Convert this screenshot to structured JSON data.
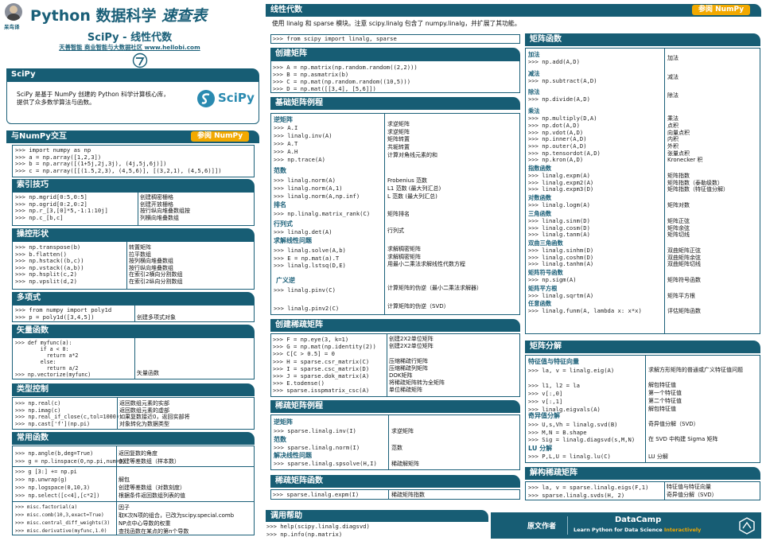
{
  "header": {
    "title": "Python 数据科学",
    "title_em": "速查表",
    "subtitle": "SciPy - 线性代数",
    "org_line1": "天善智能 商业智能与大数据社区",
    "org_url": "www.hellobi.com",
    "author": "呆鸟译"
  },
  "scipy": {
    "title": "SciPy",
    "text": "SciPy 是基于 NumPy 创建的 Python 科学计算核心库，\n提供了众多数学算法与函数。",
    "logo": "SciPy"
  },
  "numpy": {
    "title": "与NumPy交互",
    "badge": "参阅 NumPy",
    "code": ">>> import numpy as np\n>>> a = np.array([1,2,3])\n>>> b = np.array([(1+5j,2j,3j), (4j,5j,6j)])\n>>> c = np.array([[(1.5,2,3), (4,5,6)], [(3,2,1), (4,5,6)]])"
  },
  "index": {
    "title": "索引技巧",
    "code": ">>> np.mgrid[0:5,0:5]\n>>> np.ogrid[0:2,0:2]\n>>> np.r_[3,[0]*5,-1:1:10j]\n>>> np.c_[b,c]",
    "desc": "创建稠密栅格\n创建开放栅格\n按行纵向堆叠数组按\n列横向堆叠数组"
  },
  "shape": {
    "title": "操控形状",
    "code": ">>> np.transpose(b)\n>>> b.flatten()\n>>> np.hstack((b,c))\n>>> np.vstack((a,b))\n>>> np.hsplit(c,2)\n>>> np.vpslit(d,2)",
    "desc": "转置矩阵\n拉平数组\n按列横向堆叠数组\n按行纵向堆叠数组\n在索引2横向分割数组\n在索引2纵向分割数组"
  },
  "poly": {
    "title": "多项式",
    "code": ">>> from numpy import poly1d\n>>> p = poly1d([3,4,5])",
    "desc": "\n创建多项式对象"
  },
  "vec": {
    "title": "矢量函数",
    "code": ">>> def myfunc(a):\n        if a < 0:\n          return a*2\n        else:\n          return a/2\n>>> np.vectorize(myfunc)",
    "desc": "矢量函数"
  },
  "type": {
    "title": "类型控制",
    "code": ">>> np.real(c)\n>>> np.imag(c)\n>>> np.real_if_close(c,tol=1000)\n>>> np.cast['f'](np.pi)",
    "desc": "返回数组元素的实部\n返回数组元素的虚部\n如果复数接近0，返回实部将\n对象转化为数据类型"
  },
  "common": {
    "title": "常用函数",
    "code1": ">>> np.angle(b,deg=True)\n>>> g = np.linspace(0,np.pi,num=5)",
    "desc1": "返回复数的角度\n创建等差数组（样本数）",
    "code2": ">>> g [3:] += np.pi\n>>> np.unwrap(g)\n>>> np.logspace(0,10,3)\n>>> np.select([c<4],[c*2])",
    "desc2": "\n解包\n创建等差数组（对数刻度）\n根据条件返回数组列表的值",
    "code3": ">>> misc.factorial(a)\n>>> misc.comb(10,3,exact=True)\n>>> misc.central_diff_weights(3)\n>>> misc.derivative(myfunc,1.0)",
    "desc3": "因子\n取K次N项的组合，已改为scipy.special.comb\nNP点中心导数的权重\n查找函数在某点的第n个导数"
  },
  "linalg": {
    "title": "线性代数",
    "badge": "参阅 NumPy",
    "intro": "使用 linalg 和 sparse 模块。注意 scipy.linalg 包含了 numpy.linalg，并扩展了其功能。",
    "import": ">>> from scipy import linalg, sparse"
  },
  "create": {
    "title": "创建矩阵",
    "code": ">>> A = np.matrix(np.random.random((2,2)))\n>>> B = np.asmatrix(b)\n>>> C = np.mat(np.random.random((10,5)))\n>>> D = np.mat([[3,4], [5,6]])"
  },
  "basic": {
    "title": "基础矩阵例程",
    "h_inv": "逆矩阵",
    "code_inv": ">>> A.I\n>>> linalg.inv(A)\n>>> A.T\n>>> A.H\n>>> np.trace(A)",
    "desc_inv": "求逆矩阵\n求逆矩阵\n矩阵转置\n共轭转置\n计算对角线元素的和",
    "h_norm": "范数",
    "code_norm": ">>> linalg.norm(A)\n>>> linalg.norm(A,1)\n>>> linalg.norm(A,np.inf)",
    "desc_norm": "Frobenius 范数\nL1 范数 (最大列汇总)\nL 范数 (最大列汇总)",
    "h_rank": "排名",
    "code_rank": ">>> np.linalg.matrix_rank(C)",
    "desc_rank": "矩阵排名",
    "h_det": "行列式",
    "code_det": ">>> linalg.det(A)",
    "desc_det": "行列式",
    "h_solve": "求解线性问题",
    "code_solve": ">>> linalg.solve(A,b)\n>>> E = np.mat(a).T\n>>> linalg.lstsq(D,E)",
    "desc_solve": "求解稠密矩阵\n求解稠密矩阵\n用最小二乘法求解线性代数方程",
    "h_pinv": "广义逆",
    "code_pinv": ">>> linalg.pinv(C)\n\n>>> linalg.pinv2(C)",
    "desc_pinv": "计算矩阵的伪逆（最小二乘法求解器）\n\n计算矩阵的伪逆（SVD）"
  },
  "sparse_create": {
    "title": "创建稀疏矩阵",
    "code": ">>> F = np.eye(3, k=1)\n>>> G = np.mat(np.identity(2))\n>>> C[C > 0.5] = 0\n>>> H = sparse.csr_matrix(C)\n>>> I = sparse.csc_matrix(D)\n>>> J = sparse.dok_matrix(A)\n>>> E.todense()\n>>> sparse.isspmatrix_csc(A)",
    "desc": "创建2X2单位矩阵\n创建2X2单位矩阵\n\n压缩稀疏行矩阵\n压缩稀疏列矩阵\nDOK矩阵\n将稀疏矩阵转为全矩阵\n单位稀疏矩阵"
  },
  "sparse_routines": {
    "title": "稀疏矩阵例程",
    "h1": "逆矩阵",
    "c1": ">>> sparse.linalg.inv(I)",
    "d1": "求逆矩阵",
    "h2": "范数",
    "c2": ">>> sparse.linalg.norm(I)",
    "d2": "范数",
    "h3": "解决线性问题",
    "c3": ">>> sparse.linalg.spsolve(H,I)",
    "d3": "稀疏解矩阵"
  },
  "sparse_func": {
    "title": "稀疏矩阵函数",
    "code": ">>> sparse.linalg.expm(I)",
    "desc": "稀疏矩阵指数"
  },
  "help": {
    "title": "调用帮助",
    "code": ">>> help(scipy.linalg.diagsvd)\n>>> np.info(np.matrix)"
  },
  "funcs": {
    "title": "矩阵函数",
    "groups": [
      {
        "h": "加法",
        "code": ">>> np.add(A,D)",
        "desc": "加法"
      },
      {
        "h": "减法",
        "code": ">>> np.subtract(A,D)",
        "desc": "减法"
      },
      {
        "h": "除法",
        "code": ">>> np.divide(A,D)",
        "desc": "除法"
      },
      {
        "h": "乘法",
        "code": ">>> np.multiply(D,A)\n>>> np.dot(A,D)\n>>> np.vdot(A,D)\n>>> np.inner(A,D)\n>>> np.outer(A,D)\n>>> np.tensordot(A,D)\n>>> np.kron(A,D)",
        "desc": "乘法\n点积\n向量点积\n内积\n外积\n张量点积\nKronecker 积"
      },
      {
        "h": "指数函数",
        "code": ">>> linalg.expm(A)\n>>> linalg.expm2(A)\n>>> linalg.expm3(D)",
        "desc": "矩阵指数\n矩阵指数（泰勒级数）\n矩阵指数（特征值分解）"
      },
      {
        "h": "对数函数",
        "code": ">>> linalg.logm(A)",
        "desc": "矩阵对数"
      },
      {
        "h": "三角函数",
        "code": ">>> linalg.sinm(D)\n>>> linalg.cosm(D)\n>>> linalg.tanm(A)",
        "desc": "矩阵正弦\n矩阵余弦\n矩阵切线"
      },
      {
        "h": "双曲三角函数",
        "code": ">>> linalg.sinhm(D)\n>>> linalg.coshm(D)\n>>> linalg.tanhm(A)",
        "desc": "双曲矩阵正弦\n双曲矩阵余弦\n双曲矩阵切线"
      },
      {
        "h": "矩阵符号函数",
        "code": ">>> np.sigm(A)",
        "desc": "矩阵符号函数"
      },
      {
        "h": "矩阵平方根",
        "code": ">>> linalg.sqrtm(A)",
        "desc": "矩阵平方根"
      },
      {
        "h": "任意函数",
        "code": ">>> linalg.funm(A, lambda x: x*x)",
        "desc": "评估矩阵函数"
      }
    ]
  },
  "decomp": {
    "title": "矩阵分解",
    "h1": "特征值与特征向量",
    "c1": ">>> la, v = linalg.eig(A)\n\n>>> l1, l2 = la\n>>> v[:,0]\n>>> v[:,1]\n>>> linalg.eigvals(A)",
    "d1": "求解方形矩阵的普通或广义特征值问题\n\n解包特征值\n第一个特征值\n第二个特征值\n解包特征值",
    "h2": "奇异值分解",
    "c2": ">>> U,s,Vh = linalg.svd(B)\n>>> M,N = B.shape\n>>> Sig = linalg.diagsvd(s,M,N)",
    "d2": "奇异值分解（SVD）\n\n在 SVD 中构建 Sigma 矩阵",
    "h3": "LU 分解",
    "c3": ">>> P,L,U = linalg.lu(C)",
    "d3": "LU 分解"
  },
  "sparse_decomp": {
    "title": "解构稀疏矩阵",
    "code": ">>> la, v = sparse.linalg.eigs(F,1)\n>>> sparse.linalg.svds(H, 2)",
    "desc": "特征值与特征向量\n奇异值分解（SVD）"
  },
  "footer": {
    "author_label": "原文作者",
    "brand": "DataCamp",
    "tagline": "Learn Python for Data Science",
    "tagline_em": "Interactively"
  }
}
